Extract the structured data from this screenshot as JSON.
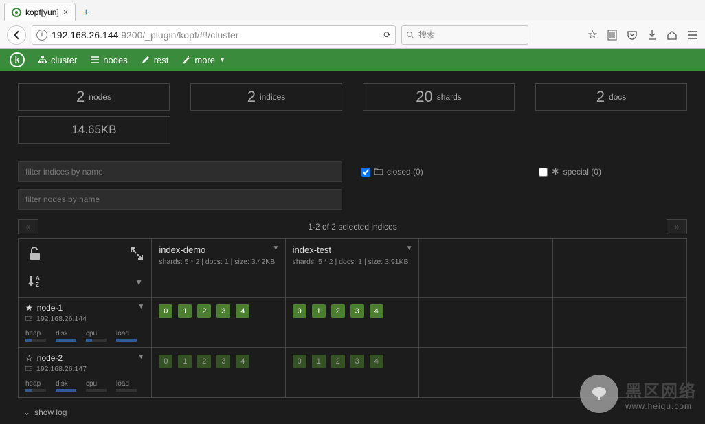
{
  "browser": {
    "tab_title": "kopf[yun]",
    "url_host": "192.168.26.144",
    "url_path": ":9200/_plugin/kopf/#!/cluster",
    "search_placeholder": "搜索"
  },
  "nav": {
    "cluster": "cluster",
    "nodes": "nodes",
    "rest": "rest",
    "more": "more"
  },
  "stats": {
    "nodes_n": "2",
    "nodes_l": "nodes",
    "indices_n": "2",
    "indices_l": "indices",
    "shards_n": "20",
    "shards_l": "shards",
    "docs_n": "2",
    "docs_l": "docs",
    "size": "14.65KB"
  },
  "filters": {
    "indices_placeholder": "filter indices by name",
    "nodes_placeholder": "filter nodes by name",
    "closed": "closed (0)",
    "special": "special (0)"
  },
  "pager": {
    "label": "1-2 of 2 selected indices"
  },
  "sort_glyph": "A\nZ",
  "indices": [
    {
      "name": "index-demo",
      "meta": "shards: 5 * 2 | docs: 1 | size: 3.42KB"
    },
    {
      "name": "index-test",
      "meta": "shards: 5 * 2 | docs: 1 | size: 3.91KB"
    }
  ],
  "shard_ids": [
    "0",
    "1",
    "2",
    "3",
    "4"
  ],
  "nodes_list": [
    {
      "name": "node-1",
      "ip": "192.168.26.144",
      "starred": true,
      "metrics": [
        "heap",
        "disk",
        "cpu",
        "load"
      ]
    },
    {
      "name": "node-2",
      "ip": "192.168.26.147",
      "starred": false,
      "metrics": [
        "heap",
        "disk",
        "cpu",
        "load"
      ]
    }
  ],
  "showlog": "show log",
  "watermark": {
    "line1": "黑区网络",
    "line2": "www.heiqu.com"
  }
}
